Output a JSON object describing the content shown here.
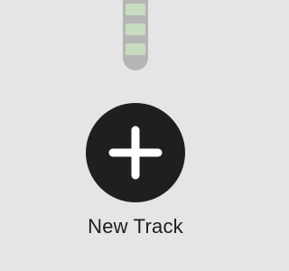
{
  "meter": {
    "segments": [
      "lit",
      "lit",
      "lit"
    ],
    "colors": {
      "body": "#b5b5b5",
      "segment": "#c8dcc0"
    }
  },
  "new_track": {
    "label": "New Track",
    "icon": "plus-icon",
    "button_color": "#1f1f1f",
    "icon_color": "#ffffff"
  }
}
